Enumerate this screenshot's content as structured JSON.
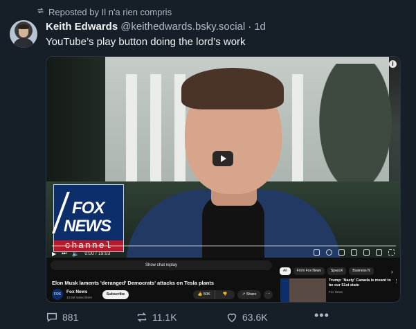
{
  "repost_line": {
    "text": "Reposted by Il n'a rien compris",
    "icon": "repost-icon"
  },
  "post": {
    "author_name": "Keith Edwards",
    "handle": "@keithedwards.bsky.social",
    "separator": "·",
    "time": "1d",
    "text": "YouTube’s play button doing the lord’s work"
  },
  "video": {
    "info_icon": "i",
    "fox_logo": {
      "line1": "FOX",
      "line2": "NEWS",
      "channel": "channel"
    },
    "progress": 0.0,
    "time_readout": "0:00 / 19:03",
    "show_chat_replay": "Show chat replay",
    "title": "Elon Musk laments 'deranged' Democrats' attacks on Tesla plants",
    "channel_logo_text": "FOX NEWS",
    "channel_name": "Fox News",
    "subscribers": "13.5M subscribers",
    "subscribe_label": "Subscribe",
    "like_count": "50K",
    "share_label": "Share",
    "more_label": "···",
    "chips": [
      "All",
      "From Fox News",
      "SpaceX",
      "Business N"
    ],
    "related": {
      "title": "Trump: 'Nasty' Canada is meant to be our 51st state",
      "channel": "Fox News"
    }
  },
  "actions": {
    "replies": "881",
    "reposts": "11.1K",
    "likes": "63.6K",
    "menu": "•••"
  },
  "colors": {
    "background": "#161e27",
    "muted_text": "#aebbc9",
    "fox_blue": "#0c2e6b",
    "fox_red": "#b6192a"
  }
}
